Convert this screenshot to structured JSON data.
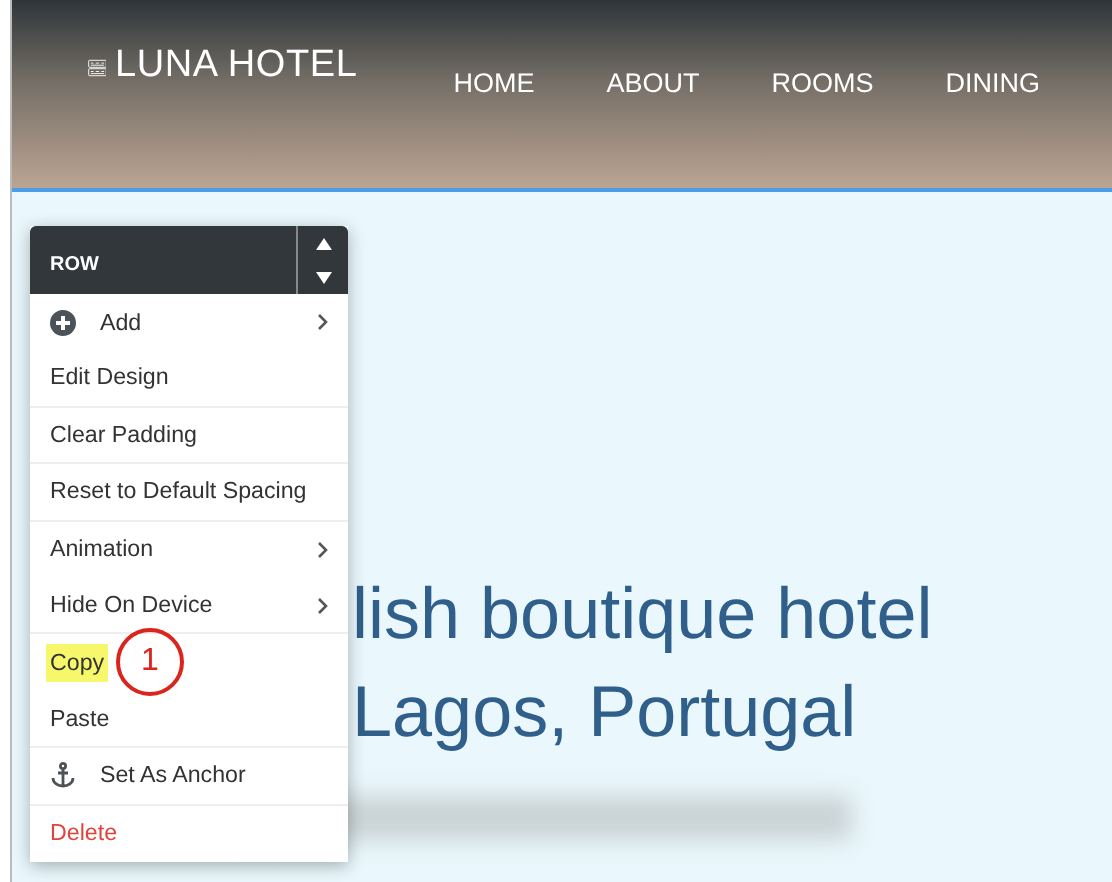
{
  "header": {
    "logo": "LUNA HOTEL",
    "nav": [
      "HOME",
      "ABOUT",
      "ROOMS",
      "DINING"
    ]
  },
  "heading": [
    "lish boutique hotel",
    "Lagos, Portugal"
  ],
  "context_menu": {
    "title": "ROW",
    "items": [
      {
        "label": "Add",
        "submenu": true,
        "highlighted": false,
        "kind": "add",
        "divider_after": false
      },
      {
        "label": "Edit Design",
        "submenu": false,
        "highlighted": false,
        "kind": "normal",
        "divider_after": true
      },
      {
        "label": "Clear Padding",
        "submenu": false,
        "highlighted": false,
        "kind": "normal",
        "divider_after": true
      },
      {
        "label": "Reset to Default Spacing",
        "submenu": false,
        "highlighted": false,
        "kind": "normal",
        "divider_after": true
      },
      {
        "label": "Animation",
        "submenu": true,
        "highlighted": false,
        "kind": "normal",
        "divider_after": false
      },
      {
        "label": "Hide On Device",
        "submenu": true,
        "highlighted": false,
        "kind": "normal",
        "divider_after": true
      },
      {
        "label": "Copy",
        "submenu": false,
        "highlighted": true,
        "kind": "normal",
        "divider_after": false,
        "annotation": "1"
      },
      {
        "label": "Paste",
        "submenu": false,
        "highlighted": false,
        "kind": "normal",
        "divider_after": true
      },
      {
        "label": "Set As Anchor",
        "submenu": false,
        "highlighted": false,
        "kind": "anchor",
        "divider_after": true
      },
      {
        "label": "Delete",
        "submenu": false,
        "highlighted": false,
        "kind": "danger",
        "divider_after": false
      }
    ]
  }
}
